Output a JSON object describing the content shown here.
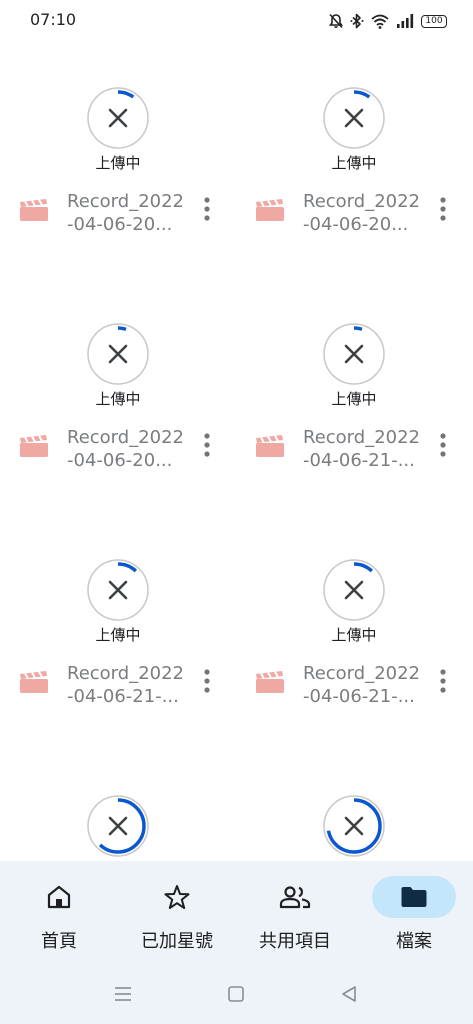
{
  "status_bar": {
    "time": "07:10",
    "battery": "100",
    "icons": [
      "mute-icon",
      "bluetooth-icon",
      "wifi-icon",
      "signal-icon",
      "battery-icon"
    ]
  },
  "files": [
    {
      "name_line1": "Record_2022",
      "name_line2": "-04-06-20...",
      "status": "上傳中",
      "progress": 0.1
    },
    {
      "name_line1": "Record_2022",
      "name_line2": "-04-06-20...",
      "status": "上傳中",
      "progress": 0.1
    },
    {
      "name_line1": "Record_2022",
      "name_line2": "-04-06-20...",
      "status": "上傳中",
      "progress": 0.05
    },
    {
      "name_line1": "Record_2022",
      "name_line2": "-04-06-21-...",
      "status": "上傳中",
      "progress": 0.05
    },
    {
      "name_line1": "Record_2022",
      "name_line2": "-04-06-21-...",
      "status": "上傳中",
      "progress": 0.12
    },
    {
      "name_line1": "Record_2022",
      "name_line2": "-04-06-21-...",
      "status": "上傳中",
      "progress": 0.12
    },
    {
      "status": "",
      "progress": 0.62
    },
    {
      "status": "",
      "progress": 0.72
    }
  ],
  "bottom_nav": {
    "items": [
      {
        "label": "首頁",
        "icon": "home-icon",
        "active": false
      },
      {
        "label": "已加星號",
        "icon": "star-icon",
        "active": false
      },
      {
        "label": "共用項目",
        "icon": "people-icon",
        "active": false
      },
      {
        "label": "檔案",
        "icon": "folder-icon",
        "active": true
      }
    ]
  },
  "system_nav": [
    "menu-icon",
    "home-square-icon",
    "back-icon"
  ],
  "colors": {
    "accent": "#0b57d0",
    "file_icon": "#f0a8a3",
    "nav_background": "#eef3f9",
    "active_pill": "#c4e6fb"
  }
}
